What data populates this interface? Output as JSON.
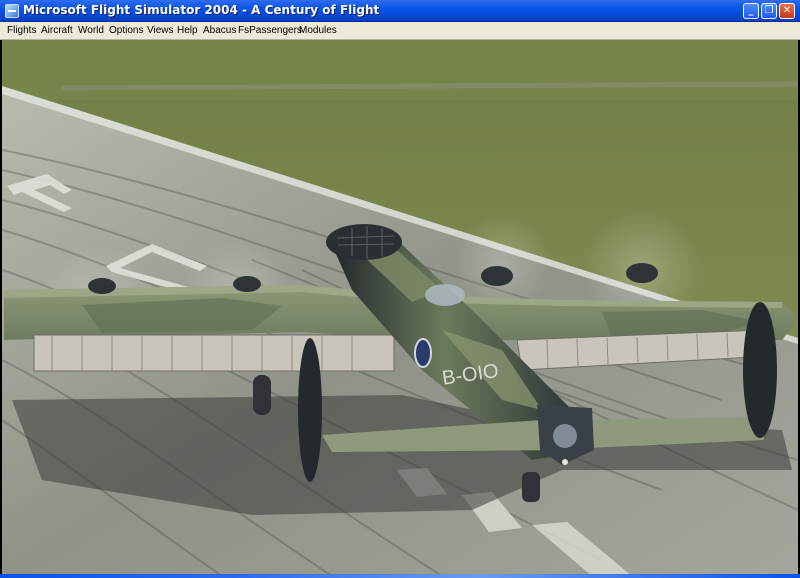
{
  "window": {
    "title": "Microsoft Flight Simulator 2004 - A Century of Flight",
    "minimize_glyph": "_",
    "maximize_glyph": "❐",
    "close_glyph": "✕"
  },
  "menu": {
    "items": [
      "Flights",
      "Aircraft",
      "World",
      "Options",
      "Views",
      "Help",
      "Abacus",
      "FsPassengers",
      "Modules"
    ]
  },
  "aircraft": {
    "code": "B-OIO"
  },
  "colors": {
    "titlebar": "#0a54e8",
    "menubar": "#ece9d8",
    "grass": "#7d8a4f",
    "runway": "#9a9d93",
    "camo_green": "#6f7d5e",
    "camo_dark": "#2c3136"
  }
}
